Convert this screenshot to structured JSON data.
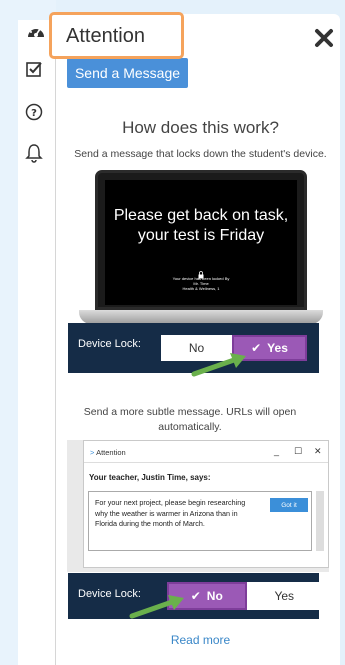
{
  "header": {
    "title": "Attention",
    "send_button": "Send a Message"
  },
  "rail": {
    "items": [
      {
        "icon": "dashboard-icon"
      },
      {
        "icon": "checkbox-icon"
      },
      {
        "icon": "help-icon"
      },
      {
        "icon": "bell-icon"
      }
    ]
  },
  "how": {
    "heading": "How does this work?",
    "description": "Send a message that locks down the student's device."
  },
  "laptop": {
    "message": "Please get back on task, your test is Friday",
    "locked_line1": "Your device has been locked By",
    "locked_line2": "Mr. Time",
    "locked_line3": "Health & Wellness, 1"
  },
  "lock_example": {
    "label": "Device Lock:",
    "no": "No",
    "yes": "Yes",
    "selected": "yes"
  },
  "subtle": {
    "description": "Send a more subtle message. URLs will open automatically."
  },
  "notification": {
    "title": "Attention",
    "from": "Your teacher, Justin Time, says:",
    "body": "For your next project, please begin researching why the weather is warmer in Arizona than in Florida during the month of March.",
    "got_it": "Got it"
  },
  "subtle_example": {
    "label": "Device Lock:",
    "no": "No",
    "yes": "Yes",
    "selected": "no"
  },
  "footer": {
    "read_more": "Read more"
  },
  "colors": {
    "accent_blue": "#4a90d9",
    "highlight_orange": "#f5a35c",
    "toggle_purple": "#9b59b6",
    "bar_navy": "#152c47",
    "arrow_green": "#6ab04c"
  }
}
